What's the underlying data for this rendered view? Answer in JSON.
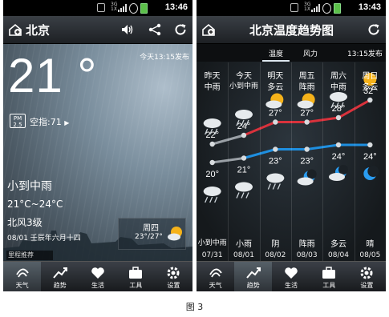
{
  "status_bar": {
    "left_time": "13:46",
    "right_time": "13:43",
    "network_label": "3G\n1X"
  },
  "left": {
    "city": "北京",
    "temperature": "21 °",
    "publish_time": "今天13:15发布",
    "pm_badge": "PM\n2.5",
    "aqi_label": "空指:71",
    "condition": "小到中雨",
    "temp_range": "21°C~24°C",
    "wind": "北风3级",
    "date_line": "08/01  壬辰年六月十四",
    "next_day": {
      "label": "周四",
      "range": "23°/27°"
    },
    "toast": "里程推荐"
  },
  "right": {
    "title": "北京温度趋势图",
    "tabs": [
      "温度",
      "风力"
    ],
    "publish_time": "13:15发布",
    "days": [
      {
        "day": "昨天",
        "weather": "中雨",
        "high": "22°",
        "low": "20°",
        "night": "小到中雨",
        "date": "07/31"
      },
      {
        "day": "今天",
        "weather": "小到中雨",
        "high": "24°",
        "low": "21°",
        "night": "小雨",
        "date": "08/01"
      },
      {
        "day": "明天",
        "weather": "多云",
        "high": "27°",
        "low": "23°",
        "night": "阴",
        "date": "08/02"
      },
      {
        "day": "周五",
        "weather": "阵雨",
        "high": "27°",
        "low": "23°",
        "night": "阵雨",
        "date": "08/03"
      },
      {
        "day": "周六",
        "weather": "中雨",
        "high": "28°",
        "low": "24°",
        "night": "多云",
        "date": "08/04"
      },
      {
        "day": "周日",
        "weather": "多云",
        "high": "32°",
        "low": "24°",
        "night": "晴",
        "date": "08/05"
      }
    ]
  },
  "tabs": [
    "天气",
    "趋势",
    "生活",
    "工具",
    "设置"
  ],
  "caption": "图 3",
  "colors": {
    "high_line": "#d9323c",
    "low_line": "#1e8fe0",
    "past_line": "#9aa0a6",
    "sun": "#f5b21a"
  }
}
